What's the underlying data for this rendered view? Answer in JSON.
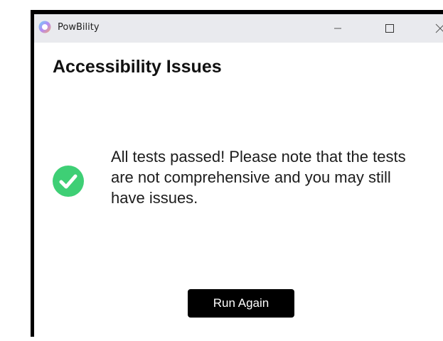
{
  "window": {
    "app_title": "PowBility",
    "controls": {
      "minimize": "minimize-icon",
      "maximize": "maximize-icon",
      "close": "close-icon"
    },
    "titlebar_color": "#e9eaee"
  },
  "content": {
    "heading": "Accessibility Issues",
    "status_icon": "check-circle-icon",
    "status_color": "#3ecf75",
    "message": "All tests passed! Please note that the tests are not comprehensive and you may still have issues.",
    "run_again_label": "Run Again",
    "button_color": "#000000"
  }
}
